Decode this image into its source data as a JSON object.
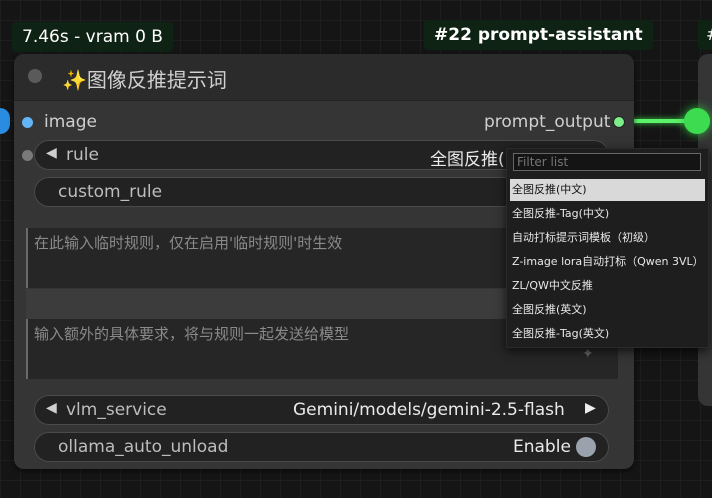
{
  "badges": {
    "stats": "7.46s - vram 0 B",
    "node_id_title": "#22 prompt-assistant",
    "right_partial": "#"
  },
  "node": {
    "title": "图像反推提示词",
    "title_icon": "sparkles-icon",
    "inputs": [
      {
        "label": "image",
        "color": "#64b5f6"
      }
    ],
    "outputs": [
      {
        "label": "prompt_output",
        "color": "#7dee8a"
      }
    ],
    "widgets": {
      "rule": {
        "label": "rule",
        "value": "全图反推(中文)"
      },
      "custom_rule": {
        "label": "custom_rule"
      },
      "custom_rule_text": {
        "placeholder": "在此输入临时规则，仅在启用'临时规则'时生效"
      },
      "extra_text": {
        "placeholder": "输入额外的具体要求，将与规则一起发送给模型"
      },
      "vlm_service": {
        "label": "vlm_service",
        "value": "Gemini/models/gemini-2.5-flash"
      },
      "ollama_auto_unload": {
        "label": "ollama_auto_unload",
        "value": "Enable"
      }
    }
  },
  "dropdown": {
    "filter_placeholder": "Filter list",
    "options": [
      "全图反推(中文)",
      "全图反推-Tag(中文)",
      "自动打标提示词模板（初级）",
      "Z-image lora自动打标（Qwen 3VL）",
      "ZL/QW中文反推",
      "全图反推(英文)",
      "全图反推-Tag(英文)"
    ],
    "selected_index": 0
  },
  "colors": {
    "link": "#5cf26a",
    "image_slot": "#64b5f6",
    "output_slot": "#7dee8a",
    "badge_bg": "#0f2314"
  }
}
